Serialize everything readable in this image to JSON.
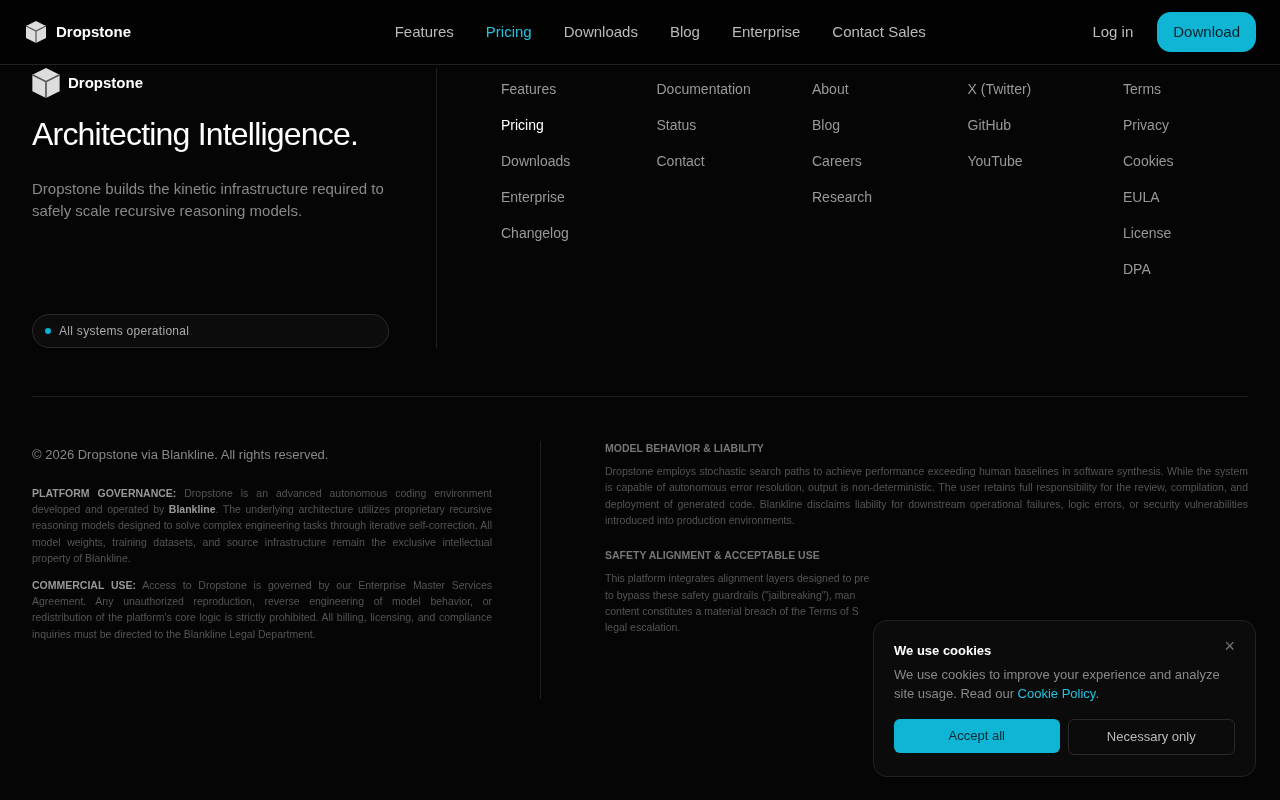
{
  "header": {
    "brand": "Dropstone",
    "nav": [
      {
        "label": "Features",
        "selected": false
      },
      {
        "label": "Pricing",
        "selected": true
      },
      {
        "label": "Downloads",
        "selected": false
      },
      {
        "label": "Blog",
        "selected": false
      },
      {
        "label": "Enterprise",
        "selected": false
      },
      {
        "label": "Contact Sales",
        "selected": false
      }
    ],
    "login": "Log in",
    "download": "Download"
  },
  "footer": {
    "brand": "Dropstone",
    "headline": "Architecting Intelligence.",
    "description": "Dropstone builds the kinetic infrastructure required to safely scale recursive reasoning models.",
    "status": {
      "label": "All systems operational",
      "color": "#06b6d4"
    },
    "link_columns": [
      [
        {
          "label": "Features",
          "selected": false
        },
        {
          "label": "Pricing",
          "selected": true
        },
        {
          "label": "Downloads",
          "selected": false
        },
        {
          "label": "Enterprise",
          "selected": false
        },
        {
          "label": "Changelog",
          "selected": false
        }
      ],
      [
        {
          "label": "Documentation",
          "selected": false
        },
        {
          "label": "Status",
          "selected": false
        },
        {
          "label": "Contact",
          "selected": false
        }
      ],
      [
        {
          "label": "About",
          "selected": false
        },
        {
          "label": "Blog",
          "selected": false
        },
        {
          "label": "Careers",
          "selected": false
        },
        {
          "label": "Research",
          "selected": false
        }
      ],
      [
        {
          "label": "X (Twitter)",
          "selected": false
        },
        {
          "label": "GitHub",
          "selected": false
        },
        {
          "label": "YouTube",
          "selected": false
        }
      ],
      [
        {
          "label": "Terms",
          "selected": false
        },
        {
          "label": "Privacy",
          "selected": false
        },
        {
          "label": "Cookies",
          "selected": false
        },
        {
          "label": "EULA",
          "selected": false
        },
        {
          "label": "License",
          "selected": false
        },
        {
          "label": "DPA",
          "selected": false
        }
      ]
    ],
    "copyright": "© 2026 Dropstone via Blankline. All rights reserved.",
    "notices": [
      {
        "text": "**PLATFORM GOVERNANCE:** Dropstone is an advanced autonomous coding environment developed and operated by **Blankline**. The underlying architecture utilizes proprietary recursive reasoning models designed to solve complex engineering tasks through iterative self-correction. All model weights, training datasets, and source infrastructure remain the exclusive intellectual property of Blankline."
      },
      {
        "text": "**COMMERCIAL USE:** Access to Dropstone is governed by our Enterprise Master Services Agreement. Any unauthorized reproduction, reverse engineering of model behavior, or redistribution of the platform's core logic is strictly prohibited. All billing, licensing, and compliance inquiries must be directed to the Blankline Legal Department."
      }
    ],
    "legal_sections": [
      {
        "title": "MODEL BEHAVIOR & LIABILITY",
        "lines": [
          "Dropstone employs stochastic search paths to achieve performance exceeding human baselines in software synthesis. While the system is capable of autonomous error resolution, output is non-deterministic. The user retains full responsibility for the review, compilation, and deployment of generated code. Blankline disclaims liability for downstream operational failures, logic errors, or security vulnerabilities introduced into production environments."
        ]
      },
      {
        "title": "SAFETY ALIGNMENT & ACCEPTABLE USE",
        "lines": [
          "This platform integrates alignment layers designed to pre",
          "to bypass these safety guardrails (\"jailbreaking\"), man",
          "content constitutes a material breach of the Terms of S",
          "legal escalation."
        ]
      }
    ]
  },
  "cookie_banner": {
    "title": "We use cookies",
    "text": "We use cookies to improve your experience and analyze site usage. Read our ",
    "link": "Cookie Policy",
    "text_end": ".",
    "accept": "Accept all",
    "necessary": "Necessary only",
    "close": "×"
  }
}
